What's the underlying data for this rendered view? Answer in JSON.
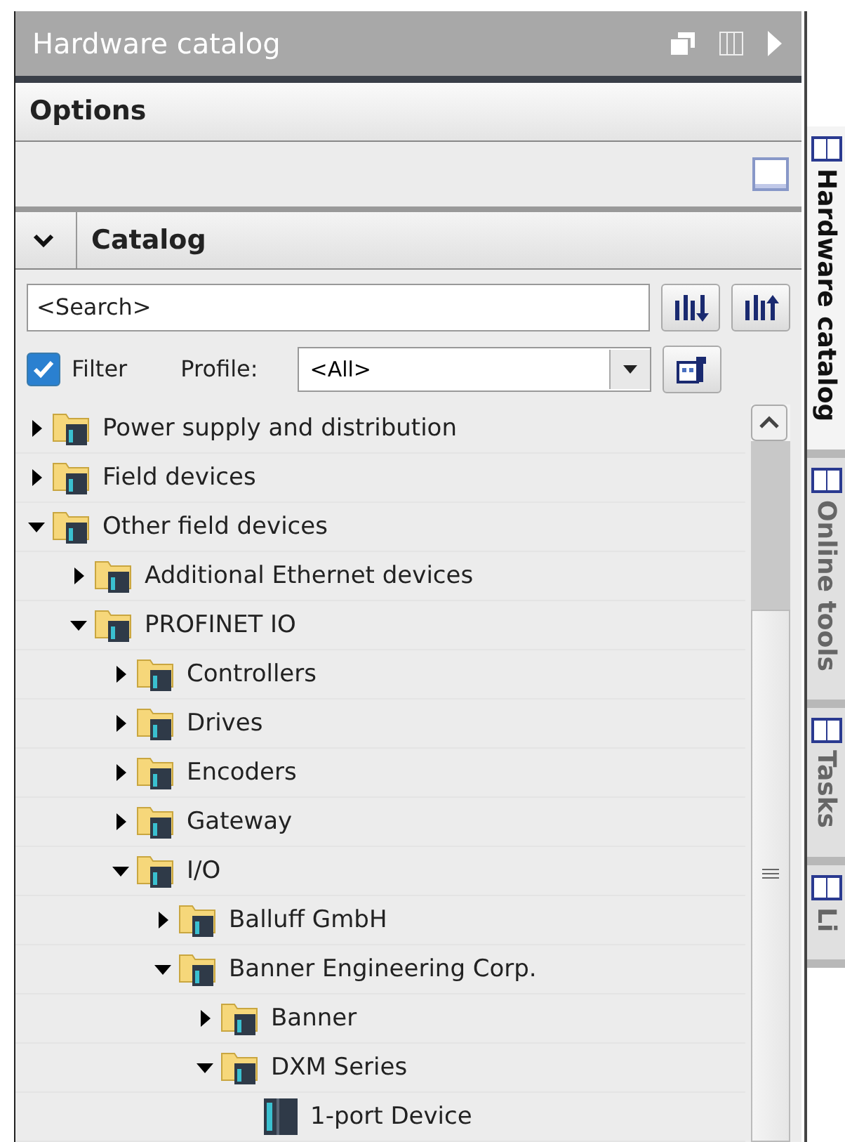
{
  "panel": {
    "title": "Hardware catalog"
  },
  "options": {
    "title": "Options"
  },
  "catalog": {
    "title": "Catalog",
    "expanded": true,
    "search": {
      "placeholder": "<Search>"
    },
    "filter": {
      "label": "Filter",
      "checked": true
    },
    "profile": {
      "label": "Profile:",
      "value": "<All>"
    },
    "tree": [
      {
        "label": "Power supply and distribution",
        "kind": "folder",
        "expanded": false
      },
      {
        "label": "Field devices",
        "kind": "folder",
        "expanded": false
      },
      {
        "label": "Other field devices",
        "kind": "folder",
        "expanded": true,
        "children": [
          {
            "label": "Additional Ethernet devices",
            "kind": "folder",
            "expanded": false
          },
          {
            "label": "PROFINET IO",
            "kind": "folder",
            "expanded": true,
            "children": [
              {
                "label": "Controllers",
                "kind": "folder",
                "expanded": false
              },
              {
                "label": "Drives",
                "kind": "folder",
                "expanded": false
              },
              {
                "label": "Encoders",
                "kind": "folder",
                "expanded": false
              },
              {
                "label": "Gateway",
                "kind": "folder",
                "expanded": false
              },
              {
                "label": "I/O",
                "kind": "folder",
                "expanded": true,
                "children": [
                  {
                    "label": "Balluff GmbH",
                    "kind": "folder",
                    "expanded": false
                  },
                  {
                    "label": "Banner Engineering Corp.",
                    "kind": "folder",
                    "expanded": true,
                    "children": [
                      {
                        "label": "Banner",
                        "kind": "folder",
                        "expanded": false
                      },
                      {
                        "label": "DXM Series",
                        "kind": "folder",
                        "expanded": true,
                        "children": [
                          {
                            "label": "1-port Device",
                            "kind": "device"
                          }
                        ]
                      }
                    ]
                  }
                ]
              }
            ]
          }
        ]
      }
    ]
  },
  "side_tabs": [
    {
      "label": "Hardware catalog",
      "selected": true
    },
    {
      "label": "Online tools",
      "selected": false
    },
    {
      "label": "Tasks",
      "selected": false
    },
    {
      "label": "Li",
      "selected": false
    }
  ]
}
